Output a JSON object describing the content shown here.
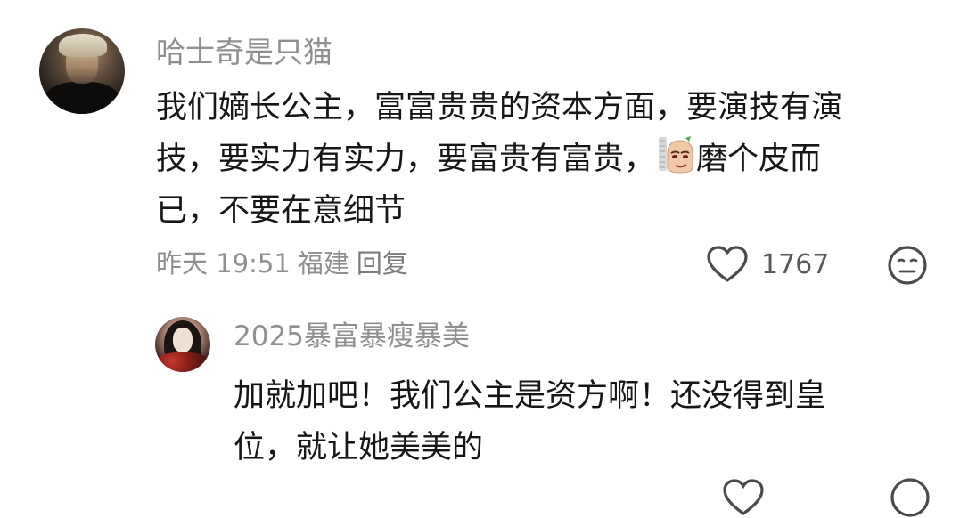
{
  "comment": {
    "username": "哈士奇是只猫",
    "lines": [
      "我们嫡长公主，富富贵贵的资本方面，要演技有演",
      "技，要实力有实力，要富贵有富贵，",
      "已，不要在意细节"
    ],
    "line2_after_sticker": "磨个皮而",
    "sticker_icon": "smirk-face-sticker",
    "time": "昨天 19:51",
    "location": "福建",
    "reply_label": "回复",
    "like_count": "1767",
    "icons": {
      "like": "heart-outline-icon",
      "dislike": "meh-face-icon"
    }
  },
  "reply": {
    "username": "2025暴富暴瘦暴美",
    "lines": [
      "加就加吧！我们公主是资方啊！还没得到皇",
      "位，就让她美美的"
    ]
  },
  "colors": {
    "text": "#161616",
    "meta": "#8f8f8f",
    "icon": "#4a4a4a",
    "background": "#ffffff"
  }
}
